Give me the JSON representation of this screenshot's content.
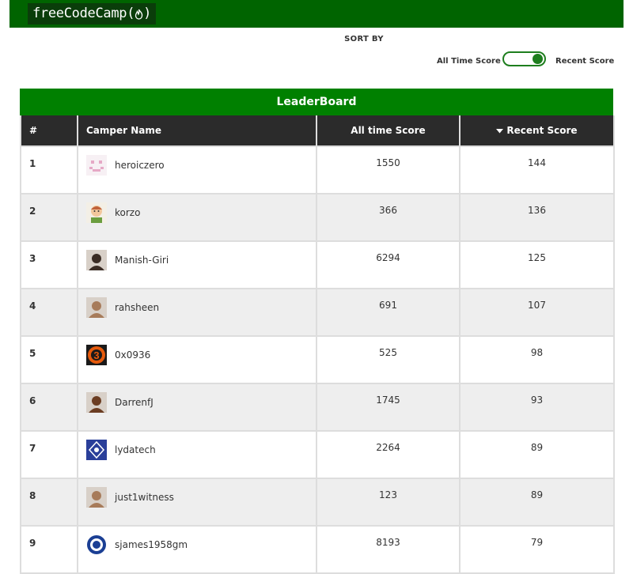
{
  "brand": {
    "name": "freeCodeCamp(",
    "close": ")",
    "icon": "flame-icon"
  },
  "sort": {
    "heading": "SORT BY",
    "left_label": "All Time Score",
    "right_label": "Recent Score",
    "selected": "Recent Score"
  },
  "board": {
    "title": "LeaderBoard",
    "columns": [
      "#",
      "Camper Name",
      "All time Score",
      "Recent Score"
    ],
    "sorted_column_icon": "caret-down-icon",
    "rows": [
      {
        "rank": "1",
        "name": "heroiczero",
        "all_time": "1550",
        "recent": "144",
        "avatar": "pixel-face-avatar"
      },
      {
        "rank": "2",
        "name": "korzo",
        "all_time": "366",
        "recent": "136",
        "avatar": "cartoon-avatar"
      },
      {
        "rank": "3",
        "name": "Manish-Giri",
        "all_time": "6294",
        "recent": "125",
        "avatar": "photo-avatar"
      },
      {
        "rank": "4",
        "name": "rahsheen",
        "all_time": "691",
        "recent": "107",
        "avatar": "photo-avatar"
      },
      {
        "rank": "5",
        "name": "0x0936",
        "all_time": "525",
        "recent": "98",
        "avatar": "orange-3-avatar"
      },
      {
        "rank": "6",
        "name": "DarrenfJ",
        "all_time": "1745",
        "recent": "93",
        "avatar": "photo-avatar"
      },
      {
        "rank": "7",
        "name": "lydatech",
        "all_time": "2264",
        "recent": "89",
        "avatar": "badge-avatar"
      },
      {
        "rank": "8",
        "name": "just1witness",
        "all_time": "123",
        "recent": "89",
        "avatar": "photo-avatar"
      },
      {
        "rank": "9",
        "name": "sjames1958gm",
        "all_time": "8193",
        "recent": "79",
        "avatar": "crest-avatar"
      }
    ]
  },
  "colors": {
    "navbar": "#006400",
    "title_bar": "#008000",
    "header_bg": "#2b2b2b",
    "toggle": "#1e7e1e"
  }
}
